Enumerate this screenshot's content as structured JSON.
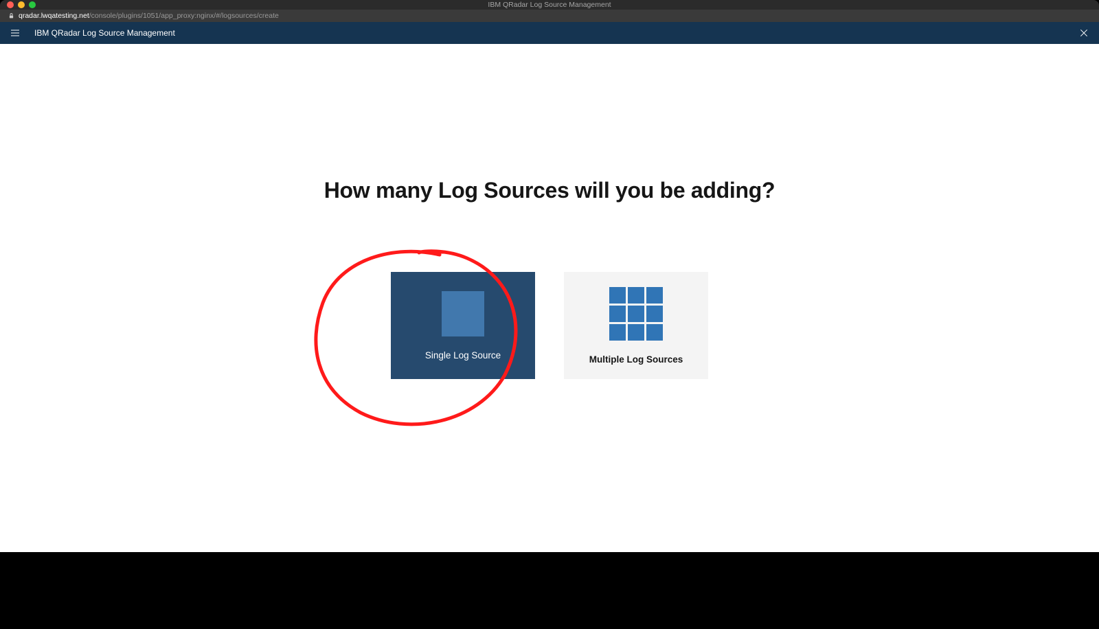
{
  "window": {
    "title": "IBM QRadar Log Source Management"
  },
  "url": {
    "host": "qradar.lwqatesting.net",
    "path": "/console/plugins/1051/app_proxy:nginx/#/logsources/create"
  },
  "header": {
    "app_title": "IBM QRadar Log Source Management"
  },
  "main": {
    "heading": "How many Log Sources will you be adding?",
    "cards": {
      "single_label": "Single Log Source",
      "multiple_label": "Multiple Log Sources"
    }
  }
}
